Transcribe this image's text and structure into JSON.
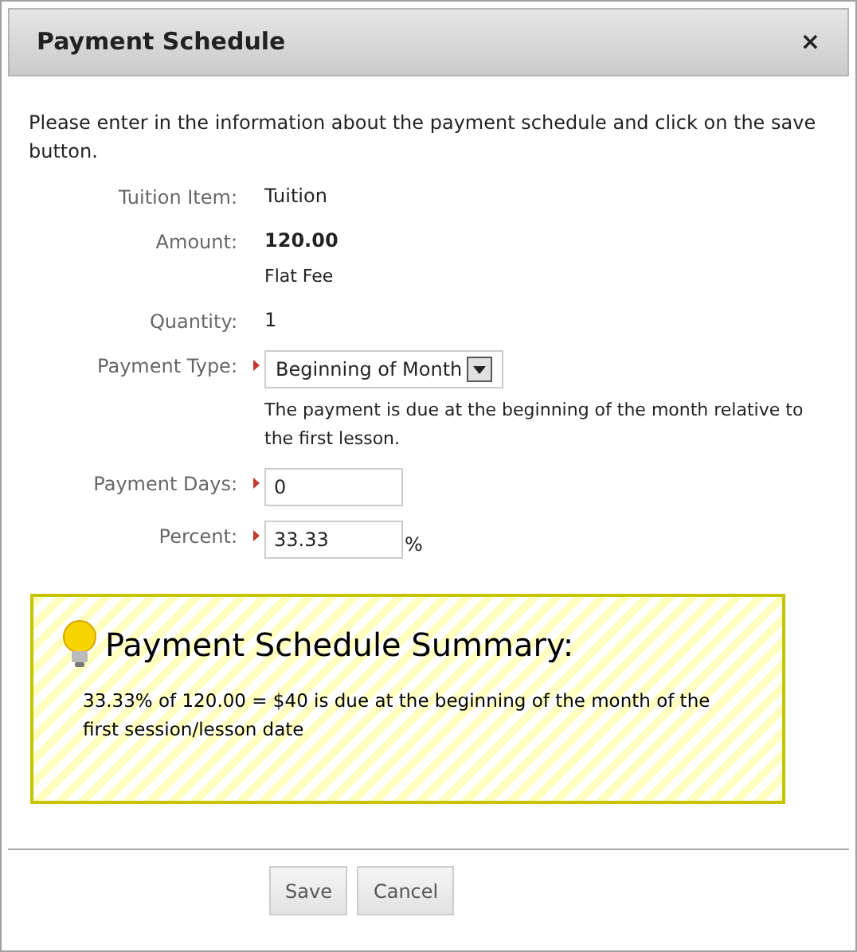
{
  "dialog": {
    "title": "Payment Schedule",
    "close": "×"
  },
  "intro": "Please enter in the information about the payment schedule and click on the save button.",
  "fields": [
    {
      "kind": "text",
      "label": "Tuition Item:",
      "value": "Tuition",
      "required": false
    },
    {
      "kind": "text",
      "label": "Amount:",
      "value": "120.00",
      "note": "Flat Fee",
      "required": false
    },
    {
      "kind": "text",
      "label": "Quantity:",
      "value": "1",
      "required": false
    },
    {
      "kind": "select",
      "label": "Payment Type:",
      "value": "Beginning of Month",
      "note": "The payment is due at the beginning of the month relative to the first lesson.",
      "required": true
    },
    {
      "kind": "input",
      "label": "Payment Days:",
      "value": "0",
      "required": true
    },
    {
      "kind": "input",
      "label": "Percent:",
      "value": "33.33",
      "suffix": "%",
      "required": true
    }
  ],
  "summary": {
    "title": "Payment Schedule Summary:",
    "text": "33.33% of 120.00 = $40 is due at the beginning of the month of the first session/lesson date"
  },
  "buttons": [
    "Save",
    "Cancel"
  ]
}
